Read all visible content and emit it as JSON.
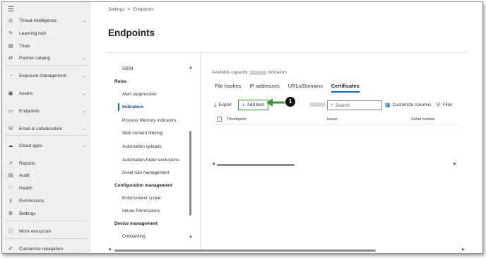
{
  "nav": {
    "items": [
      {
        "label": "Threat intelligence",
        "icon": "radar-icon",
        "chev": true
      },
      {
        "label": "Learning hub",
        "icon": "learning-icon",
        "chev": false
      },
      {
        "label": "Trials",
        "icon": "trials-icon",
        "chev": false
      },
      {
        "label": "Partner catalog",
        "icon": "partner-icon",
        "chev": true
      },
      {
        "label": "Exposure management",
        "icon": "exposure-icon",
        "chev": true
      },
      {
        "label": "Assets",
        "icon": "assets-icon",
        "chev": true
      },
      {
        "label": "Endpoints",
        "icon": "endpoints-icon",
        "chev": true
      },
      {
        "label": "Email & collaboration",
        "icon": "email-icon",
        "chev": true
      },
      {
        "label": "Cloud apps",
        "icon": "cloud-icon",
        "chev": true
      },
      {
        "label": "Reports",
        "icon": "reports-icon",
        "chev": false
      },
      {
        "label": "Audit",
        "icon": "audit-icon",
        "chev": false
      },
      {
        "label": "Health",
        "icon": "health-icon",
        "chev": false
      },
      {
        "label": "Permissions",
        "icon": "permissions-icon",
        "chev": false
      },
      {
        "label": "Settings",
        "icon": "gear-icon",
        "chev": false
      },
      {
        "label": "More resources",
        "icon": "info-icon",
        "chev": false
      },
      {
        "label": "Customize navigation",
        "icon": "pencil-icon",
        "chev": false
      }
    ]
  },
  "breadcrumb": {
    "parent": "Settings",
    "separator": ">",
    "current": "Endpoints"
  },
  "page": {
    "title": "Endpoints"
  },
  "settings_panel": {
    "items": [
      {
        "label": "SIEM",
        "type": "item"
      },
      {
        "label": "Rules",
        "type": "header"
      },
      {
        "label": "Alert suppression",
        "type": "item"
      },
      {
        "label": "Indicators",
        "type": "active"
      },
      {
        "label": "Process Memory Indicators",
        "type": "item"
      },
      {
        "label": "Web content filtering",
        "type": "item"
      },
      {
        "label": "Automation uploads",
        "type": "item"
      },
      {
        "label": "Automation folder exclusions",
        "type": "item"
      },
      {
        "label": "Asset rule management",
        "type": "item"
      },
      {
        "label": "Configuration management",
        "type": "header"
      },
      {
        "label": "Enforcement scope",
        "type": "item"
      },
      {
        "label": "Intune Permissions",
        "type": "item"
      },
      {
        "label": "Device management",
        "type": "header"
      },
      {
        "label": "Onboarding",
        "type": "item"
      }
    ]
  },
  "content": {
    "capacity_label": "Available capacity:",
    "capacity_suffix": "indicators",
    "tabs": [
      "File hashes",
      "IP addresses",
      "URLs/Domains",
      "Certificates"
    ],
    "selected_tab": "Certificates",
    "toolbar": {
      "export": "Export",
      "add_item": "Add item",
      "search_placeholder": "Search",
      "customize_columns": "Customize columns",
      "filter": "Filter"
    },
    "columns": [
      "Thumbprint",
      "Issuer",
      "Serial number"
    ],
    "callout_number": "1"
  },
  "colors": {
    "accent": "#0f6cbd",
    "highlight": "#3d9a35",
    "nav_bg": "#f0f0f0"
  }
}
